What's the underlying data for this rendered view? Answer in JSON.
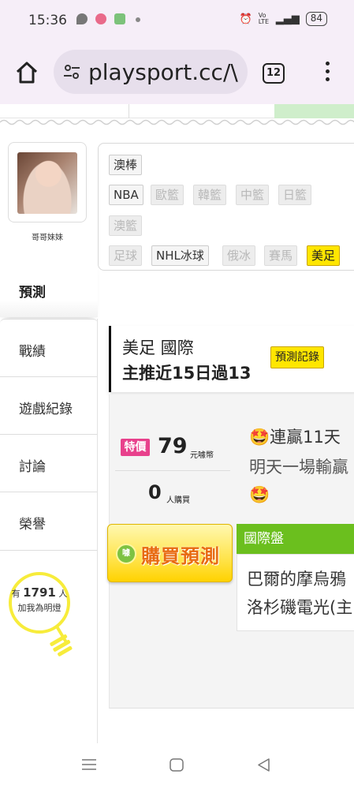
{
  "status_bar": {
    "time": "15:36",
    "signal_text": "Vo LTE",
    "battery": "84"
  },
  "browser": {
    "url": "playsport.cc/\\",
    "tab_count": "12"
  },
  "profile": {
    "nickname": "哥哥妹妹"
  },
  "nav": {
    "items": [
      "預測",
      "戰績",
      "遊戲紀錄",
      "討論",
      "榮譽"
    ]
  },
  "followers": {
    "prefix": "有",
    "count": "1791",
    "suffix": "人",
    "caption": "加我為明燈"
  },
  "filters": {
    "items": [
      {
        "label": "澳棒",
        "state": "normal"
      },
      {
        "label": "NBA",
        "state": "normal"
      },
      {
        "label": "歐籃",
        "state": "disabled"
      },
      {
        "label": "韓籃",
        "state": "disabled"
      },
      {
        "label": "中籃",
        "state": "disabled"
      },
      {
        "label": "日籃",
        "state": "disabled"
      },
      {
        "label": "澳籃",
        "state": "disabled"
      },
      {
        "label": "足球",
        "state": "disabled"
      },
      {
        "label": "NHL冰球",
        "state": "normal"
      },
      {
        "label": "俄冰",
        "state": "disabled"
      },
      {
        "label": "賽馬",
        "state": "disabled"
      },
      {
        "label": "美足",
        "state": "selected"
      }
    ]
  },
  "prediction": {
    "title": "美足 國際",
    "subtitle": "主推近15日過13",
    "record_button": "預測記錄",
    "sale_badge": "特價",
    "price": "79",
    "price_unit": "元噱幣",
    "buyers": "0",
    "buyers_unit": "人購買",
    "promo_line1": "🤩連贏11天",
    "promo_line2": "明天一場輸贏",
    "promo_line3": "🤩",
    "buy_icon_text": "噱",
    "buy_button": "購買預測",
    "market_header": "國際盤",
    "team1": "巴爾的摩烏鴉",
    "team2": "洛杉磯電光(主"
  },
  "colors": {
    "accent_yellow": "#ffe600",
    "sale_pink": "#e8418c",
    "market_green": "#6bbf1e",
    "buy_text_orange": "#e86a10"
  }
}
